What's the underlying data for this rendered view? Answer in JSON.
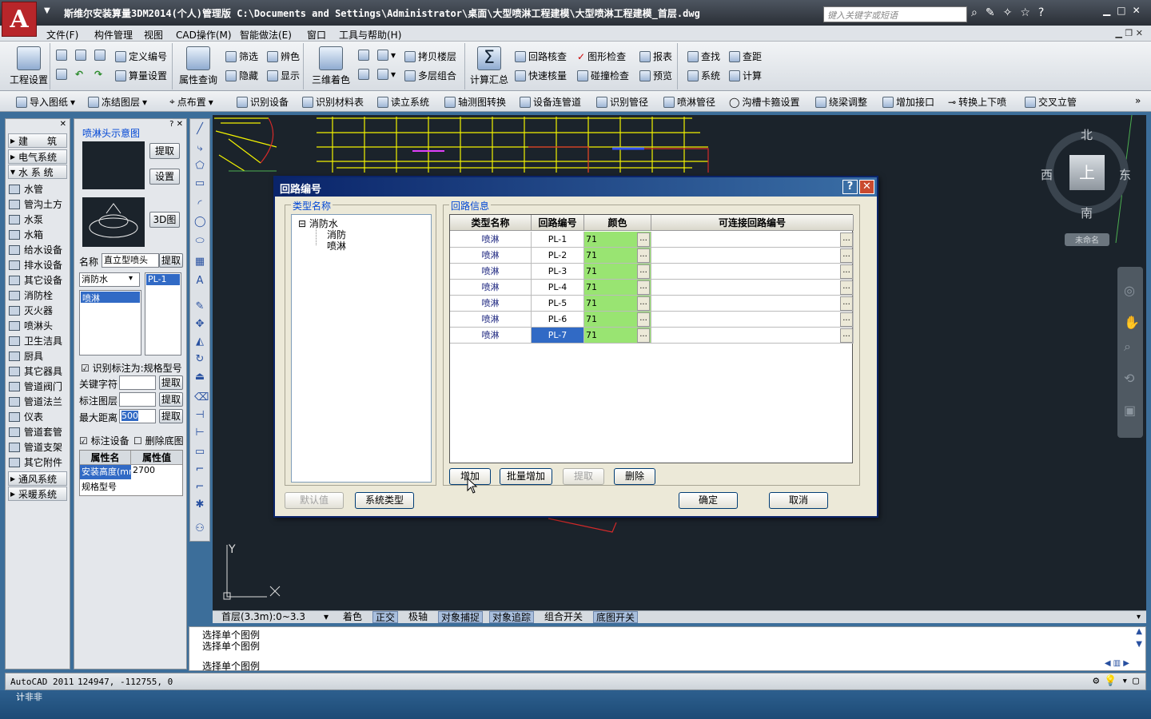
{
  "window": {
    "title": "斯维尔安装算量3DM2014(个人)管理版   C:\\Documents and Settings\\Administrator\\桌面\\大型喷淋工程建模\\大型喷淋工程建模_首层.dwg",
    "search_placeholder": "键入关键字或短语",
    "logo_letter": "A"
  },
  "menu": [
    "文件(F)",
    "构件管理",
    "视图",
    "CAD操作(M)",
    "智能做法(E)",
    "窗口",
    "工具与帮助(H)"
  ],
  "ribbon": {
    "g1": {
      "project": "工程设置"
    },
    "g2": {
      "define": "定义编号",
      "calc_settings": "算量设置"
    },
    "g3": {
      "attr_query": "属性查询",
      "filter": "筛选",
      "hide": "隐藏",
      "recolor": "辨色",
      "show": "显示"
    },
    "g4": {
      "color3d": "三维着色",
      "copy_floor": "拷贝楼层",
      "multi_combo": "多层组合"
    },
    "g5": {
      "summary": "计算汇总",
      "loop_check": "回路核查",
      "quick_check": "快速核量",
      "graph_check": "图形检查",
      "collision": "碰撞检查",
      "report": "报表",
      "preview": "预览"
    },
    "g6": {
      "find": "查找",
      "system": "系统",
      "distance": "查距",
      "calc": "计算"
    }
  },
  "toolbar2": [
    "导入图纸",
    "冻结图层",
    "点布置",
    "识别设备",
    "识别材料表",
    "读立系统",
    "轴测图转换",
    "设备连管道",
    "识别管径",
    "喷淋管径",
    "沟槽卡箍设置",
    "绕梁调整",
    "增加接口",
    "转换上下喷",
    "交叉立管"
  ],
  "left_panel": {
    "heads": [
      "建　　筑",
      "电气系统",
      "水 系 统"
    ],
    "items": [
      "水管",
      "管沟土方",
      "水泵",
      "水箱",
      "给水设备",
      "排水设备",
      "其它设备",
      "消防栓",
      "灭火器",
      "喷淋头",
      "卫生洁具",
      "厨具",
      "其它器具",
      "管道阀门",
      "管道法兰",
      "仪表",
      "管道套管",
      "管道支架",
      "其它附件"
    ],
    "foot_heads": [
      "通风系统",
      "采暖系统"
    ]
  },
  "prop_panel": {
    "preview_label": "喷淋头示意图",
    "btn_extract": "提取",
    "btn_settings": "设置",
    "btn_3d": "3D图",
    "name_label": "名称",
    "name_value": "直立型喷头",
    "system_value": "消防水",
    "loop_value": "PL-1",
    "system_type": "喷淋",
    "identify_label": "识别标注为:规格型号",
    "keyword_label": "关键字符",
    "layer_label": "标注图层",
    "maxdist_label": "最大距离",
    "maxdist_value": "500",
    "mark_device": "标注设备",
    "del_base": "删除底图",
    "attr_header_name": "属性名",
    "attr_header_value": "属性值",
    "attrs": [
      {
        "name": "安装高度(mm)",
        "value": "2700"
      },
      {
        "name": "规格型号",
        "value": ""
      }
    ]
  },
  "compass": {
    "north": "北",
    "south": "南",
    "east": "东",
    "west": "西",
    "top": "上",
    "ucs": "未命名"
  },
  "dialog": {
    "title": "回路编号",
    "type_group": "类型名称",
    "loop_group": "回路信息",
    "tree_root": "消防水",
    "tree_children": [
      "消防",
      "喷淋"
    ],
    "headers": [
      "类型名称",
      "回路编号",
      "颜色",
      "可连接回路编号"
    ],
    "rows": [
      {
        "type": "喷淋",
        "loop": "PL-1",
        "color": "71"
      },
      {
        "type": "喷淋",
        "loop": "PL-2",
        "color": "71"
      },
      {
        "type": "喷淋",
        "loop": "PL-3",
        "color": "71"
      },
      {
        "type": "喷淋",
        "loop": "PL-4",
        "color": "71"
      },
      {
        "type": "喷淋",
        "loop": "PL-5",
        "color": "71"
      },
      {
        "type": "喷淋",
        "loop": "PL-6",
        "color": "71"
      },
      {
        "type": "喷淋",
        "loop": "PL-7",
        "color": "71"
      }
    ],
    "btn_add": "增加",
    "btn_batch_add": "批量增加",
    "btn_extract": "提取",
    "btn_delete": "删除",
    "btn_default": "默认值",
    "btn_system_type": "系统类型",
    "btn_ok": "确定",
    "btn_cancel": "取消"
  },
  "status": {
    "floor": "首层(3.3m):0~3.3",
    "toggles": [
      "着色",
      "正交",
      "极轴",
      "对象捕捉",
      "对象追踪",
      "组合开关",
      "底图开关"
    ]
  },
  "command": {
    "lines": [
      "选择单个图例",
      "选择单个图例"
    ],
    "prompt": "选择单个图例"
  },
  "bottom": {
    "app": "AutoCAD 2011",
    "coords": "124947, -112755, 0",
    "below": "计非非"
  }
}
